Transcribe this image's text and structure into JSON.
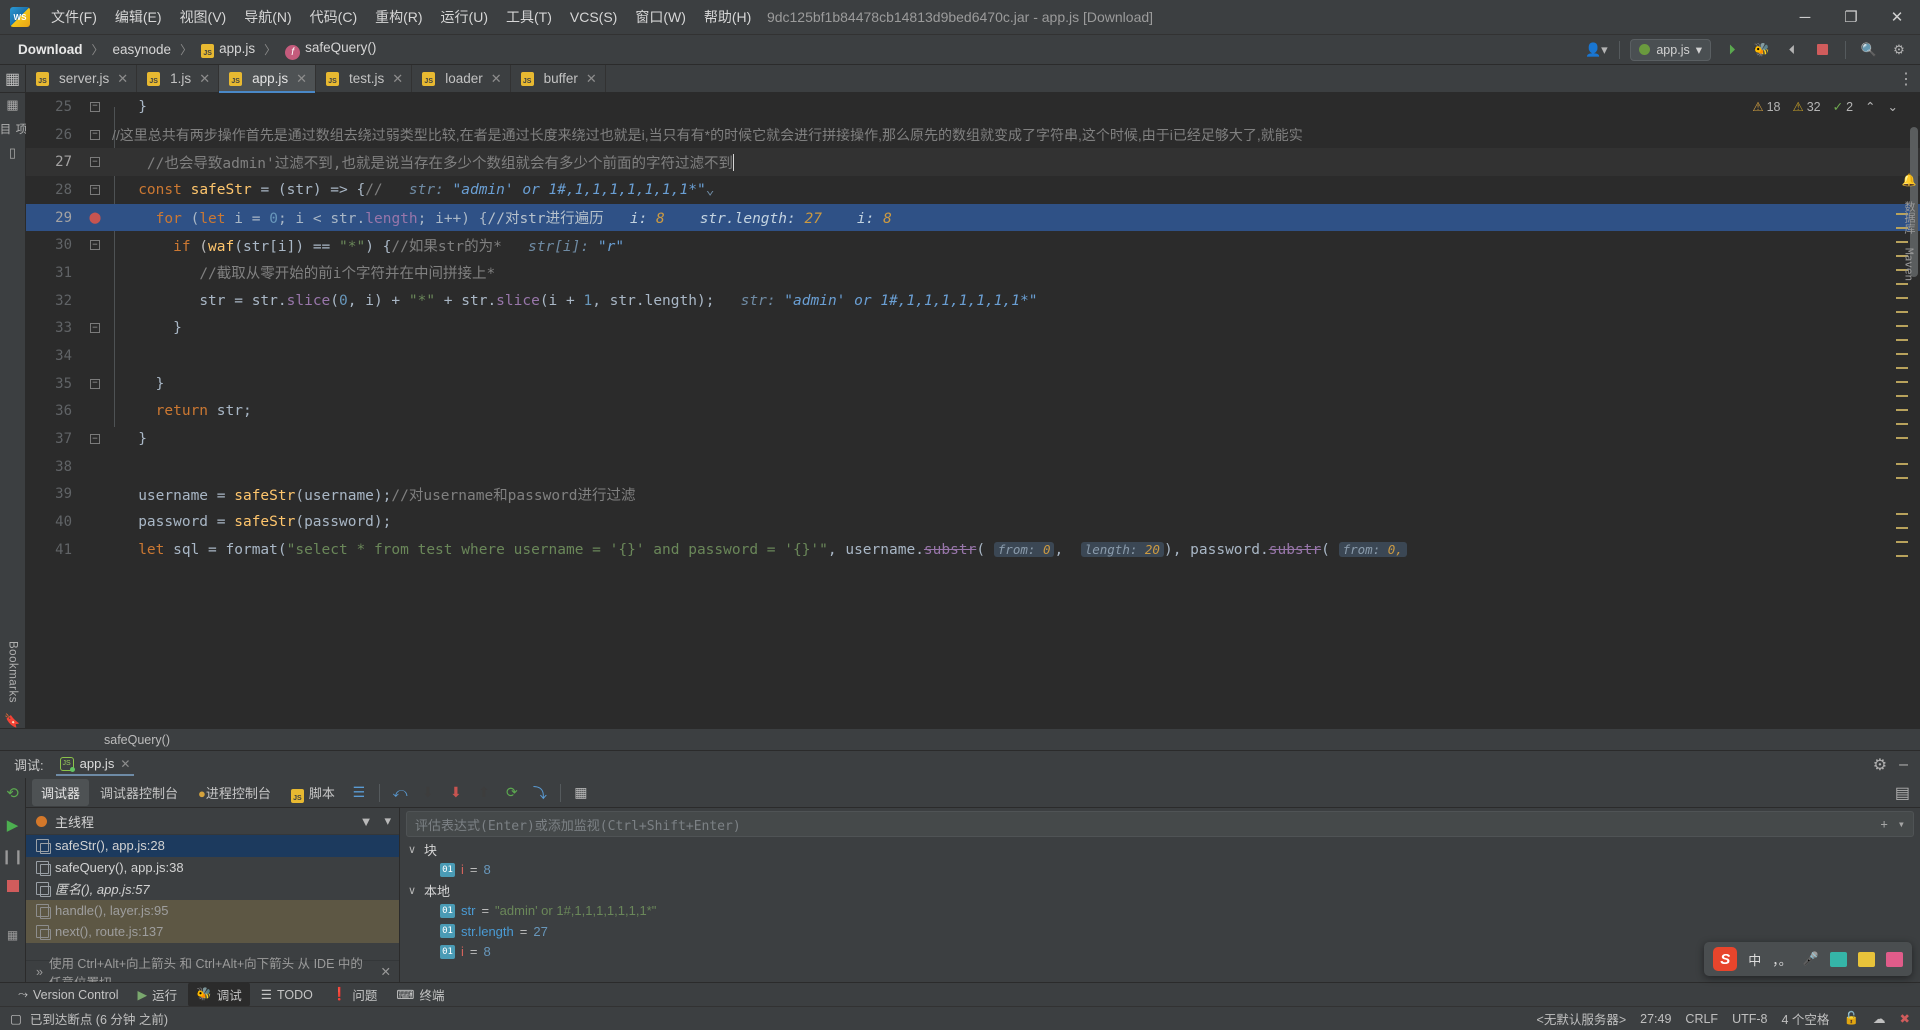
{
  "window": {
    "title": "9dc125bf1b84478cb14813d9bed6470c.jar - app.js [Download]",
    "minimize": "─",
    "maximize": "❐",
    "close": "✕",
    "logo_text": "WS"
  },
  "menu": {
    "items": [
      {
        "label": "文件(F)"
      },
      {
        "label": "编辑(E)"
      },
      {
        "label": "视图(V)"
      },
      {
        "label": "导航(N)"
      },
      {
        "label": "代码(C)"
      },
      {
        "label": "重构(R)"
      },
      {
        "label": "运行(U)"
      },
      {
        "label": "工具(T)"
      },
      {
        "label": "VCS(S)"
      },
      {
        "label": "窗口(W)"
      },
      {
        "label": "帮助(H)"
      }
    ]
  },
  "breadcrumb": {
    "items": [
      {
        "label": "Download",
        "icon": "",
        "bold": true
      },
      {
        "label": "easynode",
        "icon": ""
      },
      {
        "label": "app.js",
        "icon": "js-file-icon"
      },
      {
        "label": "safeQuery()",
        "icon": "function-icon"
      }
    ],
    "separator": "〉"
  },
  "navbar_right": {
    "account_icon": "user-account-icon",
    "run_config_label": "app.js",
    "run_icon": "run-icon",
    "debug_icon": "debug-icon",
    "coverage_icon": "coverage-icon",
    "stop_icon": "stop-icon",
    "search_icon": "search-icon",
    "settings_icon": "settings-icon"
  },
  "tabs": {
    "items": [
      {
        "label": "server.js",
        "active": false
      },
      {
        "label": "1.js",
        "active": false
      },
      {
        "label": "app.js",
        "active": true
      },
      {
        "label": "test.js",
        "active": false
      },
      {
        "label": "loader",
        "active": false
      },
      {
        "label": "buffer",
        "active": false
      }
    ],
    "close_glyph": "✕",
    "more_glyph": "⋮"
  },
  "inspections": {
    "warnings": "18",
    "errors": "32",
    "ok": "2",
    "warn_glyph": "⚠",
    "err_glyph": "⚠",
    "ok_glyph": "✓",
    "chev_down": "⌄",
    "chev_up": "⌃"
  },
  "editor": {
    "lines": [
      {
        "n": "25",
        "state": "normal",
        "fold": "minus"
      },
      {
        "n": "26",
        "state": "normal",
        "fold": "minusarrow"
      },
      {
        "n": "27",
        "state": "hl",
        "fold": "minus"
      },
      {
        "n": "28",
        "state": "normal",
        "fold": "minus"
      },
      {
        "n": "29",
        "state": "current",
        "fold": "breakpoint"
      },
      {
        "n": "30",
        "state": "normal",
        "fold": "minus"
      },
      {
        "n": "31",
        "state": "normal",
        "fold": ""
      },
      {
        "n": "32",
        "state": "normal",
        "fold": ""
      },
      {
        "n": "33",
        "state": "normal",
        "fold": "minus"
      },
      {
        "n": "34",
        "state": "normal",
        "fold": ""
      },
      {
        "n": "35",
        "state": "normal",
        "fold": "minus"
      },
      {
        "n": "36",
        "state": "normal",
        "fold": ""
      },
      {
        "n": "37",
        "state": "normal",
        "fold": "minus"
      },
      {
        "n": "38",
        "state": "normal",
        "fold": ""
      },
      {
        "n": "39",
        "state": "normal",
        "fold": ""
      },
      {
        "n": "40",
        "state": "normal",
        "fold": ""
      },
      {
        "n": "41",
        "state": "normal",
        "fold": ""
      }
    ],
    "text": {
      "l25": "}",
      "l26_comment": "//这里总共有两步操作首先是通过数组去绕过弱类型比较,在者是通过长度来绕过也就是i,当只有有*的时候它就会进行拼接操作,那么原先的数组就变成了字符串,这个时候,由于i已经足够大了,就能实",
      "l27_comment_a": "//也会导致",
      "l27_typo": "admin'",
      "l27_comment_b": "过滤不到,也就是说当存在多少个数组就会有多少个前面的字符过滤不到",
      "l28_kw": "const",
      "l28_fn": "safeStr",
      "l28_eq": "= (str) => {",
      "l28_cmt": "//",
      "l28_hint_label": "str:",
      "l28_hint_value": "\"admin' or 1#,1,1,1,1,1,1,1*\"",
      "l28_chev": "⌄",
      "l29_kw1": "for",
      "l29_kw2": "let",
      "l29_body1": " (",
      "l29_i": "i",
      "l29_assign": " = ",
      "l29_zero": "0",
      "l29_semi": "; ",
      "l29_cond": "i < str.",
      "l29_length": "length",
      "l29_inc": "; i++) {",
      "l29_cmt": "//对str进行遍历",
      "l29_h1_name": "i:",
      "l29_h1_val": "8",
      "l29_h2_name": "str.length:",
      "l29_h2_val": "27",
      "l29_h3_name": "i:",
      "l29_h3_val": "8",
      "l30_kw": "if",
      "l30_waf": "waf",
      "l30_body": "(str[i]) == ",
      "l30_star": "\"*\"",
      "l30_end": ") {",
      "l30_cmt": "//如果str的为*",
      "l30_hint_name": "str[i]:",
      "l30_hint_val": "\"r\"",
      "l31_cmt": "//截取从零开始的前i个字符并在中间拼接上*",
      "l32_a": "str = str.",
      "l32_slice1": "slice",
      "l32_b": "(",
      "l32_zero": "0",
      "l32_c": ", i) + ",
      "l32_star": "\"*\"",
      "l32_d": " + str.",
      "l32_slice2": "slice",
      "l32_e": "(i + ",
      "l32_one": "1",
      "l32_f": ", str.length);",
      "l32_hint_name": "str:",
      "l32_hint_val": "\"admin' or 1#,1,1,1,1,1,1,1*\"",
      "l33": "}",
      "l35": "}",
      "l36_kw": "return",
      "l36_var": " str;",
      "l37": "}",
      "l39_a": "username = ",
      "l39_fn": "safeStr",
      "l39_b": "(username);",
      "l39_cmt": "//对username和password进行过滤",
      "l40_a": "password = ",
      "l40_fn": "safeStr",
      "l40_b": "(password);",
      "l41_kw": "let",
      "l41_a": " sql = ",
      "l41_fmt": "format",
      "l41_b": "(",
      "l41_str": "\"select * from test where username = '{}' and password = '{}'\"",
      "l41_c": ", username.",
      "l41_substr1": "substr",
      "l41_inlay_from": "from:",
      "l41_inlay_from_v": "0",
      "l41_inlay_len": "length:",
      "l41_inlay_len_v": "20",
      "l41_d": ", password.",
      "l41_substr2": "substr",
      "l41_inlay_from2": "from:",
      "l41_inlay_from2_v": "0,"
    }
  },
  "editor_status": {
    "label": "safeQuery()"
  },
  "left_rail": {
    "project_label": "项目",
    "structure_icon": "structure-icon",
    "bookmarks_label": "Bookmarks",
    "bookmark_icon": "bookmark-icon"
  },
  "right_rail": {
    "notifications_icon": "notifications-icon",
    "database_label": "数据库",
    "maven_label": "Maven"
  },
  "debug": {
    "panel_label": "调试:",
    "tab_label": "app.js",
    "close_glyph": "✕",
    "settings_icon": "gear-icon",
    "minimize_icon": "minimize-icon",
    "layout_icon": "layout-icon",
    "rerun_icon": "rerun-icon",
    "toolbar_tabs": [
      {
        "label": "调试器",
        "selected": true
      },
      {
        "label": "调试器控制台",
        "selected": false
      },
      {
        "label": "进程控制台",
        "selected": false
      },
      {
        "label": "脚本",
        "selected": false
      }
    ],
    "toolbar_icons": [
      {
        "name": "frames-icon",
        "glyph": "≡"
      },
      {
        "name": "step-over-icon",
        "glyph": "⤴"
      },
      {
        "name": "step-into-icon",
        "glyph": "↓"
      },
      {
        "name": "force-step-into-icon",
        "glyph": "↓"
      },
      {
        "name": "step-out-icon",
        "glyph": "↑"
      },
      {
        "name": "run-to-cursor-icon",
        "glyph": "⟳"
      },
      {
        "name": "evaluate-expression-icon",
        "glyph": "⤷"
      },
      {
        "name": "show-memory-icon",
        "glyph": "▦"
      }
    ],
    "thread": {
      "label": "主线程",
      "filter_icon": "filter-icon",
      "dropdown_icon": "chevron-down-icon"
    },
    "frames": [
      {
        "label": "safeStr(), app.js:28",
        "state": "sel",
        "italic": false
      },
      {
        "label": "safeQuery(), app.js:38",
        "state": "",
        "italic": false
      },
      {
        "label": "匿名(), app.js:57",
        "state": "",
        "italic": true
      },
      {
        "label": "handle(), layer.js:95",
        "state": "lib",
        "italic": false
      },
      {
        "label": "next(), route.js:137",
        "state": "lib",
        "italic": false
      }
    ],
    "frames_hint": "使用 Ctrl+Alt+向上箭头 和 Ctrl+Alt+向下箭头 从 IDE 中的任意位置切",
    "frames_hint_expand": "»",
    "watch_placeholder": "评估表达式(Enter)或添加监视(Ctrl+Shift+Enter)",
    "watch_add_icon": "add-watch-icon",
    "watch_menu_icon": "chevron-down-icon",
    "variable_groups": [
      {
        "name": "块",
        "expanded": true,
        "chevron": "∨",
        "vars": [
          {
            "badge": "01",
            "name": "i",
            "eq": "=",
            "value": "8",
            "type": "num",
            "name_kind": "i"
          }
        ]
      },
      {
        "name": "本地",
        "expanded": true,
        "chevron": "∨",
        "vars": [
          {
            "badge": "01",
            "name": "str",
            "eq": "=",
            "value": "\"admin' or 1#,1,1,1,1,1,1,1*\"",
            "type": "str",
            "name_kind": "name"
          },
          {
            "badge": "01",
            "name": "str.length",
            "eq": "=",
            "value": "27",
            "type": "num",
            "name_kind": "name"
          },
          {
            "badge": "01",
            "name": "i",
            "eq": "=",
            "value": "8",
            "type": "num",
            "name_kind": "i"
          }
        ]
      }
    ]
  },
  "tool_strip": {
    "items": [
      {
        "label": "Version Control",
        "icon": "branch-icon",
        "selected": false
      },
      {
        "label": "运行",
        "icon": "run-icon",
        "selected": false
      },
      {
        "label": "调试",
        "icon": "debug-icon",
        "selected": true
      },
      {
        "label": "TODO",
        "icon": "todo-icon",
        "selected": false
      },
      {
        "label": "问题",
        "icon": "problems-icon",
        "selected": false
      },
      {
        "label": "终端",
        "icon": "terminal-icon",
        "selected": false
      }
    ]
  },
  "statusbar": {
    "message": "已到达断点 (6 分钟 之前)",
    "message_icon": "breakpoint-hit-icon",
    "server": "<无默认服务器>",
    "caret": "27:49",
    "line_sep": "CRLF",
    "encoding": "UTF-8",
    "indent": "4 个空格",
    "lock_icon": "lock-icon",
    "cloud_icon": "cloud-settings-icon",
    "error_icon": "error-icon"
  },
  "ime": {
    "logo": "sogou-logo",
    "mode": "中",
    "punctuation": "，。",
    "mic_icon": "microphone-icon",
    "keyboard_icon": "keyboard-icon",
    "toolbox_icon": "toolbox-icon",
    "menu_icon": "menu-icon"
  },
  "colors": {
    "bg": "#3c3f41",
    "editor_bg": "#2b2b2b",
    "current_line": "#2f5186",
    "accent": "#4a88c7",
    "keyword": "#cc7832",
    "string": "#6a8759",
    "number": "#6897bb",
    "comment": "#808080",
    "function": "#ffc66d"
  }
}
